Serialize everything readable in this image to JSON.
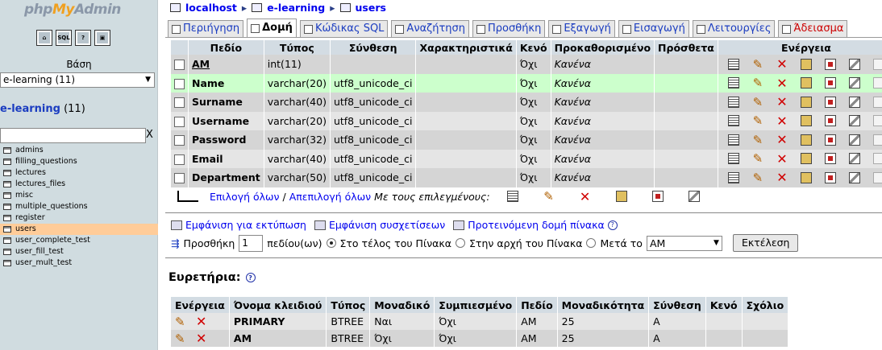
{
  "sidebar": {
    "logo_php": "php",
    "logo_my": "My",
    "logo_admin": "Admin",
    "nav_icons": [
      "home-icon",
      "sql-icon",
      "docs-icon",
      "query-window-icon"
    ],
    "db_label": "Βάση",
    "db_select": "e-learning (11)",
    "db_name": "e-learning",
    "db_count": "(11)",
    "filter_clear": "X",
    "tables": [
      "admins",
      "filling_questions",
      "lectures",
      "lectures_files",
      "misc",
      "multiple_questions",
      "register",
      "users",
      "user_complete_test",
      "user_fill_test",
      "user_mult_test"
    ],
    "selected_table": "users"
  },
  "breadcrumb": {
    "server": "localhost",
    "database": "e-learning",
    "table": "users"
  },
  "tabs": [
    {
      "label": "Περιήγηση",
      "icon": "browse-icon"
    },
    {
      "label": "Δομή",
      "icon": "structure-icon",
      "active": true
    },
    {
      "label": "Κώδικας SQL",
      "icon": "sql-icon"
    },
    {
      "label": "Αναζήτηση",
      "icon": "search-icon"
    },
    {
      "label": "Προσθήκη",
      "icon": "insert-icon"
    },
    {
      "label": "Εξαγωγή",
      "icon": "export-icon"
    },
    {
      "label": "Εισαγωγή",
      "icon": "import-icon"
    },
    {
      "label": "Λειτουργίες",
      "icon": "operations-icon"
    },
    {
      "label": "Άδειασμα",
      "icon": "empty-icon",
      "danger": true
    }
  ],
  "structure": {
    "headers": [
      "Πεδίο",
      "Τύπος",
      "Σύνθεση",
      "Χαρακτηριστικά",
      "Κενό",
      "Προκαθορισμένο",
      "Πρόσθετα",
      "Ενέργεια"
    ],
    "rows": [
      {
        "field": "AM",
        "type": "int(11)",
        "collation": "",
        "attributes": "",
        "null": "Όχι",
        "default": "Κανένα",
        "extra": ""
      },
      {
        "field": "Name",
        "type": "varchar(20)",
        "collation": "utf8_unicode_ci",
        "attributes": "",
        "null": "Όχι",
        "default": "Κανένα",
        "extra": ""
      },
      {
        "field": "Surname",
        "type": "varchar(40)",
        "collation": "utf8_unicode_ci",
        "attributes": "",
        "null": "Όχι",
        "default": "Κανένα",
        "extra": ""
      },
      {
        "field": "Username",
        "type": "varchar(20)",
        "collation": "utf8_unicode_ci",
        "attributes": "",
        "null": "Όχι",
        "default": "Κανένα",
        "extra": ""
      },
      {
        "field": "Password",
        "type": "varchar(32)",
        "collation": "utf8_unicode_ci",
        "attributes": "",
        "null": "Όχι",
        "default": "Κανένα",
        "extra": ""
      },
      {
        "field": "Email",
        "type": "varchar(40)",
        "collation": "utf8_unicode_ci",
        "attributes": "",
        "null": "Όχι",
        "default": "Κανένα",
        "extra": ""
      },
      {
        "field": "Department",
        "type": "varchar(50)",
        "collation": "utf8_unicode_ci",
        "attributes": "",
        "null": "Όχι",
        "default": "Κανένα",
        "extra": ""
      }
    ],
    "highlighted_row": 1
  },
  "checkall": {
    "check": "Επιλογή όλων",
    "sep": " / ",
    "uncheck": "Απεπιλογή όλων",
    "with_selected": "Με τους επιλεγμένους:"
  },
  "links": {
    "print": "Εμφάνιση για εκτύπωση",
    "relations": "Εμφάνιση συσχετίσεων",
    "propose": "Προτεινόμενη δομή πίνακα"
  },
  "add_field": {
    "label": "Προσθήκη",
    "count": "1",
    "unit": "πεδίου(ων)",
    "opt_end": "Στο τέλος του Πίνακα",
    "opt_begin": "Στην αρχή του Πίνακα",
    "opt_after": "Μετά το",
    "after_value": "AM",
    "go": "Εκτέλεση"
  },
  "indexes": {
    "title": "Ευρετήρια:",
    "headers": [
      "Ενέργεια",
      "Όνομα κλειδιού",
      "Τύπος",
      "Μοναδικό",
      "Συμπιεσμένο",
      "Πεδίο",
      "Μοναδικότητα",
      "Σύνθεση",
      "Κενό",
      "Σχόλιο"
    ],
    "rows": [
      {
        "key": "PRIMARY",
        "type": "BTREE",
        "unique": "Ναι",
        "packed": "Όχι",
        "field": "AM",
        "cardinality": "25",
        "collation": "A",
        "null": "",
        "comment": ""
      },
      {
        "key": "AM",
        "type": "BTREE",
        "unique": "Όχι",
        "packed": "Όχι",
        "field": "AM",
        "cardinality": "25",
        "collation": "A",
        "null": "",
        "comment": ""
      }
    ]
  }
}
